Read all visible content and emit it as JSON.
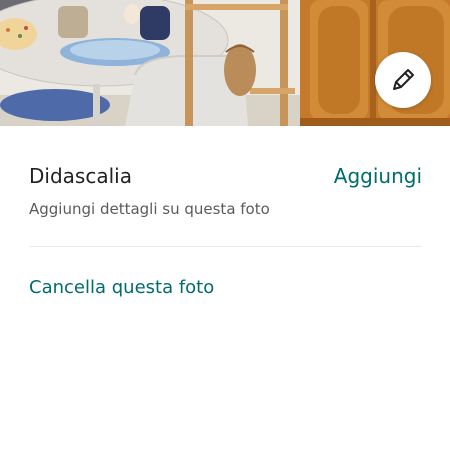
{
  "photo": {
    "edit_icon": "pencil-icon"
  },
  "caption": {
    "title": "Didascalia",
    "add_label": "Aggiungi",
    "hint": "Aggiungi dettagli su questa foto"
  },
  "actions": {
    "delete_label": "Cancella questa foto"
  },
  "colors": {
    "accent": "#006c6e",
    "text_primary": "#222222",
    "text_secondary": "#5b5b5b",
    "divider": "#ebebeb"
  }
}
